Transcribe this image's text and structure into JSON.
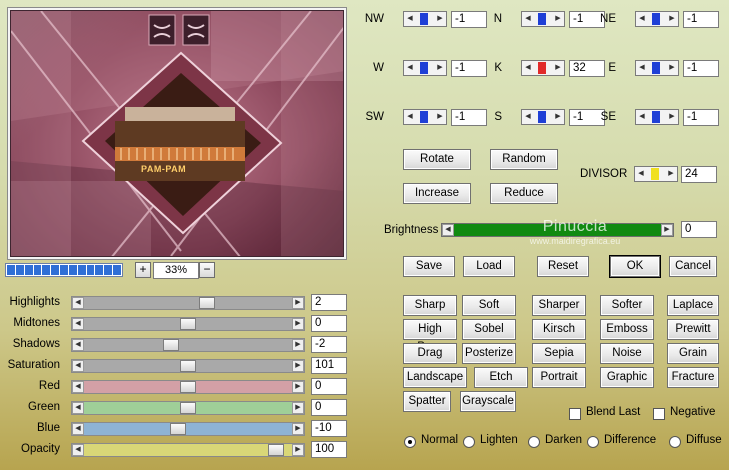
{
  "zoom": {
    "level": "33%",
    "plus": "+",
    "minus": "−",
    "progress_segments": 13
  },
  "preview": {
    "sign_text": "PAM-PAM"
  },
  "sliders": [
    {
      "id": "highlights",
      "label": "Highlights",
      "value": "2",
      "fill": "#a9a9a9",
      "position": 0.6
    },
    {
      "id": "midtones",
      "label": "Midtones",
      "value": "0",
      "fill": "#a9a9a9",
      "position": 0.5
    },
    {
      "id": "shadows",
      "label": "Shadows",
      "value": "-2",
      "fill": "#a9a9a9",
      "position": 0.41
    },
    {
      "id": "saturation",
      "label": "Saturation",
      "value": "101",
      "fill": "#a9a9a9",
      "position": 0.5
    },
    {
      "id": "red",
      "label": "Red",
      "value": "0",
      "fill": "#d3a0a6",
      "position": 0.5
    },
    {
      "id": "green",
      "label": "Green",
      "value": "0",
      "fill": "#9fcf98",
      "position": 0.5
    },
    {
      "id": "blue",
      "label": "Blue",
      "value": "-10",
      "fill": "#8eb3d4",
      "position": 0.45
    },
    {
      "id": "opacity",
      "label": "Opacity",
      "value": "100",
      "fill": "#d9d777",
      "position": 0.96
    }
  ],
  "directions": [
    {
      "id": "nw",
      "label": "NW",
      "value": "-1",
      "thumb": "#1f3fd6"
    },
    {
      "id": "n",
      "label": "N",
      "value": "-1",
      "thumb": "#1f3fd6"
    },
    {
      "id": "ne",
      "label": "NE",
      "value": "-1",
      "thumb": "#1f3fd6"
    },
    {
      "id": "w",
      "label": "W",
      "value": "-1",
      "thumb": "#1f3fd6"
    },
    {
      "id": "k",
      "label": "K",
      "value": "32",
      "thumb": "#e12a2a"
    },
    {
      "id": "e",
      "label": "E",
      "value": "-1",
      "thumb": "#1f3fd6"
    },
    {
      "id": "sw",
      "label": "SW",
      "value": "-1",
      "thumb": "#1f3fd6"
    },
    {
      "id": "s",
      "label": "S",
      "value": "-1",
      "thumb": "#1f3fd6"
    },
    {
      "id": "se",
      "label": "SE",
      "value": "-1",
      "thumb": "#1f3fd6"
    }
  ],
  "actions": {
    "rotate": "Rotate",
    "random": "Random",
    "increase": "Increase",
    "reduce": "Reduce"
  },
  "divisor": {
    "label": "DIVISOR",
    "value": "24",
    "thumb": "#f0e020"
  },
  "brightness": {
    "label": "Brightness",
    "value": "0",
    "fill": "#118a11"
  },
  "watermark": {
    "name": "Pinuccia",
    "url": "www.maidiregrafica.eu"
  },
  "dialog": {
    "save": "Save",
    "load": "Load",
    "reset": "Reset",
    "ok": "OK",
    "cancel": "Cancel"
  },
  "filters": [
    [
      "Sharp",
      "Soft",
      "Sharper",
      "Softer",
      "Laplace"
    ],
    [
      "High Pass",
      "Sobel",
      "Kirsch",
      "Emboss",
      "Prewitt"
    ],
    [
      "Drag",
      "Posterize",
      "Sepia",
      "Noise",
      "Grain"
    ],
    [
      "Landscape",
      "Etch",
      "Portrait",
      "Graphic",
      "Fracture"
    ],
    [
      "Spatter",
      "Grayscale"
    ]
  ],
  "checkboxes": {
    "blend_last": "Blend Last",
    "negative": "Negative"
  },
  "blend_modes": [
    "Normal",
    "Lighten",
    "Darken",
    "Difference",
    "Diffuse"
  ],
  "blend_selected": "Normal",
  "arrows": {
    "left": "◀",
    "right": "▶"
  }
}
